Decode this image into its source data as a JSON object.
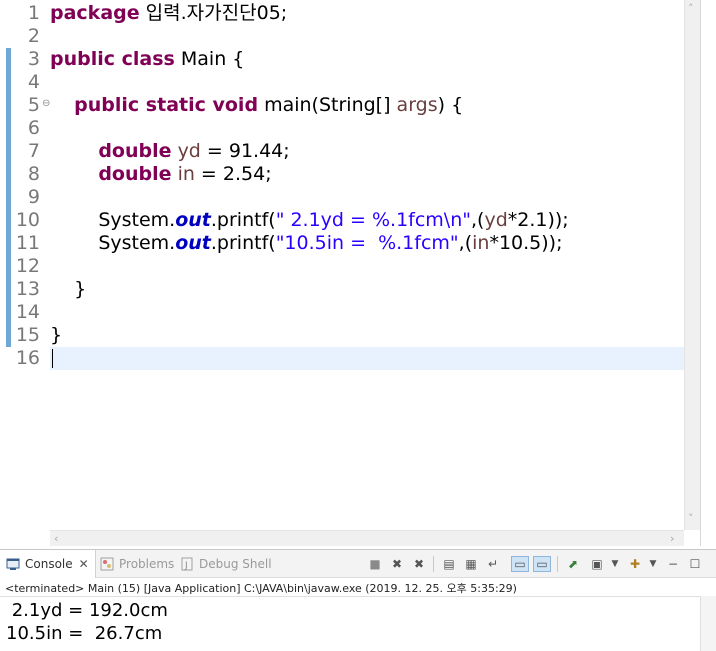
{
  "editor": {
    "line_numbers": [
      "1",
      "2",
      "3",
      "4",
      "5",
      "6",
      "7",
      "8",
      "9",
      "10",
      "11",
      "12",
      "13",
      "14",
      "15",
      "16"
    ],
    "fold_marker": "⊖",
    "code": {
      "l1_kw": "package",
      "l1_rest": " 입력.자가진단05;",
      "l3_kw": "public class",
      "l3_rest": " Main {",
      "l5_kw": "public static void",
      "l5_a": " main(String[] ",
      "l5_var": "args",
      "l5_b": ") {",
      "l7_kw": "double",
      "l7_sp": " ",
      "l7_var": "yd",
      "l7_rest": " = 91.44;",
      "l8_kw": "double",
      "l8_sp": " ",
      "l8_var": "in",
      "l8_rest": " = 2.54;",
      "l10_a": "System.",
      "l10_fld": "out",
      "l10_b": ".printf(",
      "l10_str": "\" 2.1yd = %.1fcm\\n\"",
      "l10_c": ",(",
      "l10_var": "yd",
      "l10_d": "*2.1));",
      "l11_a": "System.",
      "l11_fld": "out",
      "l11_b": ".printf(",
      "l11_str": "\"10.5in =  %.1fcm\"",
      "l11_c": ",(",
      "l11_var": "in",
      "l11_d": "*10.5));",
      "l13": "}",
      "l15": "}"
    },
    "ruler_mark_lines": [
      3,
      4,
      5,
      6,
      7,
      8,
      9,
      10,
      11,
      12,
      13,
      14,
      15
    ]
  },
  "console": {
    "tabs": [
      {
        "label": "Console",
        "icon": "console-icon",
        "active": true
      },
      {
        "label": "Problems",
        "icon": "problems-icon",
        "active": false
      },
      {
        "label": "Debug Shell",
        "icon": "debug-shell-icon",
        "active": false
      }
    ],
    "close_glyph": "✕",
    "status": "<terminated> Main (15) [Java Application] C:\\JAVA\\bin\\javaw.exe (2019. 12. 25. 오후 5:35:29)",
    "output": [
      " 2.1yd = 192.0cm",
      "10.5in =  26.7cm"
    ]
  },
  "colors": {
    "keyword": "#7f0055",
    "string": "#2a00ff",
    "field": "#0000c0",
    "local_var": "#6a3e3e",
    "current_line": "#e8f2fe",
    "ruler_mark": "#6fa8d6"
  }
}
